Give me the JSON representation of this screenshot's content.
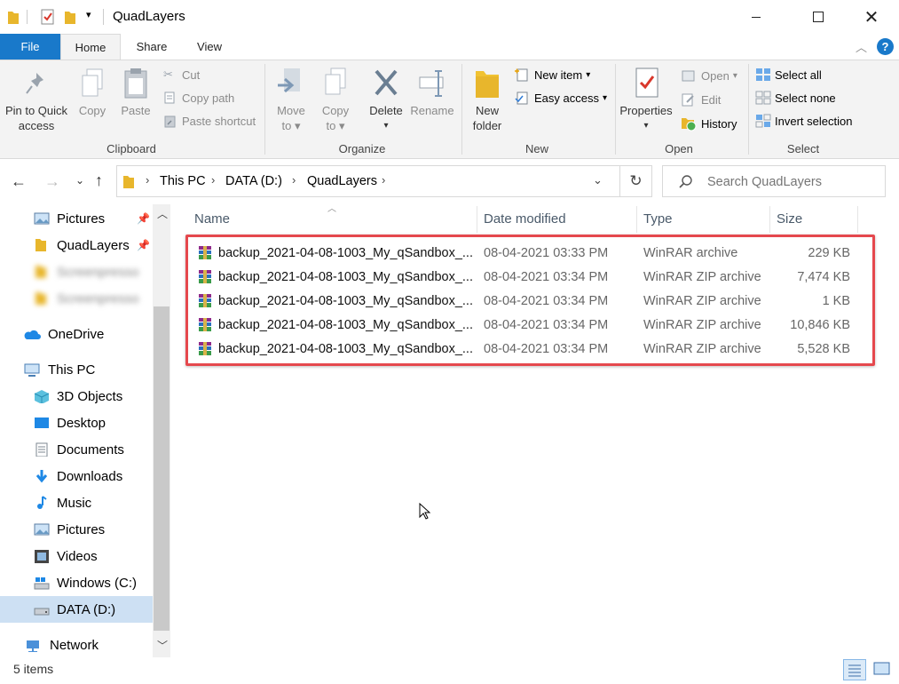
{
  "window": {
    "title": "QuadLayers",
    "controls": [
      "minimize-icon",
      "maximize-icon",
      "close-icon"
    ]
  },
  "ribbon_tabs": [
    {
      "label": "File"
    },
    {
      "label": "Home"
    },
    {
      "label": "Share"
    },
    {
      "label": "View"
    }
  ],
  "clipboard": {
    "pin_label_1": "Pin to Quick",
    "pin_label_2": "access",
    "copy": "Copy",
    "paste": "Paste",
    "cut": "Cut",
    "copy_path": "Copy path",
    "paste_shortcut": "Paste shortcut",
    "group": "Clipboard"
  },
  "organize": {
    "move_to_1": "Move",
    "move_to_2": "to",
    "copy_to_1": "Copy",
    "copy_to_2": "to",
    "delete": "Delete",
    "rename": "Rename",
    "group": "Organize"
  },
  "new_group": {
    "new_folder_1": "New",
    "new_folder_2": "folder",
    "new_item": "New item",
    "easy_access": "Easy access",
    "group": "New"
  },
  "open_group": {
    "properties": "Properties",
    "open": "Open",
    "edit": "Edit",
    "history": "History",
    "group": "Open"
  },
  "select_group": {
    "select_all": "Select all",
    "select_none": "Select none",
    "invert_selection": "Invert selection",
    "group": "Select"
  },
  "address": {
    "crumbs": [
      "This PC",
      "DATA (D:)",
      "QuadLayers"
    ],
    "search_placeholder": "Search QuadLayers"
  },
  "nav": [
    {
      "label": "Pictures",
      "icon": "pictures-icon",
      "pinned": true
    },
    {
      "label": "QuadLayers",
      "icon": "folder-icon",
      "pinned": true
    },
    {
      "label": "Screenpresso",
      "icon": "folder-icon",
      "blurred": true
    },
    {
      "label": "Screenpresso",
      "icon": "folder-icon",
      "blurred": true
    },
    {
      "label": "OneDrive",
      "icon": "onedrive-icon"
    },
    {
      "label": "This PC",
      "icon": "this-pc-icon"
    },
    {
      "label": "3D Objects",
      "icon": "3d-objects-icon"
    },
    {
      "label": "Desktop",
      "icon": "desktop-icon"
    },
    {
      "label": "Documents",
      "icon": "documents-icon"
    },
    {
      "label": "Downloads",
      "icon": "downloads-icon"
    },
    {
      "label": "Music",
      "icon": "music-icon"
    },
    {
      "label": "Pictures",
      "icon": "pictures-icon"
    },
    {
      "label": "Videos",
      "icon": "videos-icon"
    },
    {
      "label": "Windows (C:)",
      "icon": "windows-drive-icon"
    },
    {
      "label": "DATA (D:)",
      "icon": "drive-icon",
      "selected": true
    },
    {
      "label": "Network",
      "icon": "network-icon"
    }
  ],
  "columns": {
    "name": "Name",
    "date": "Date modified",
    "type": "Type",
    "size": "Size"
  },
  "files": [
    {
      "name": "backup_2021-04-08-1003_My_qSandbox_...",
      "date": "08-04-2021 03:33 PM",
      "type": "WinRAR archive",
      "size": "229 KB"
    },
    {
      "name": "backup_2021-04-08-1003_My_qSandbox_...",
      "date": "08-04-2021 03:34 PM",
      "type": "WinRAR ZIP archive",
      "size": "7,474 KB"
    },
    {
      "name": "backup_2021-04-08-1003_My_qSandbox_...",
      "date": "08-04-2021 03:34 PM",
      "type": "WinRAR ZIP archive",
      "size": "1 KB"
    },
    {
      "name": "backup_2021-04-08-1003_My_qSandbox_...",
      "date": "08-04-2021 03:34 PM",
      "type": "WinRAR ZIP archive",
      "size": "10,846 KB"
    },
    {
      "name": "backup_2021-04-08-1003_My_qSandbox_...",
      "date": "08-04-2021 03:34 PM",
      "type": "WinRAR ZIP archive",
      "size": "5,528 KB"
    }
  ],
  "status": {
    "item_count": "5 items"
  },
  "colors": {
    "accent": "#1979ca",
    "highlight": "#e5484d",
    "selected_nav": "#cde0f3"
  }
}
